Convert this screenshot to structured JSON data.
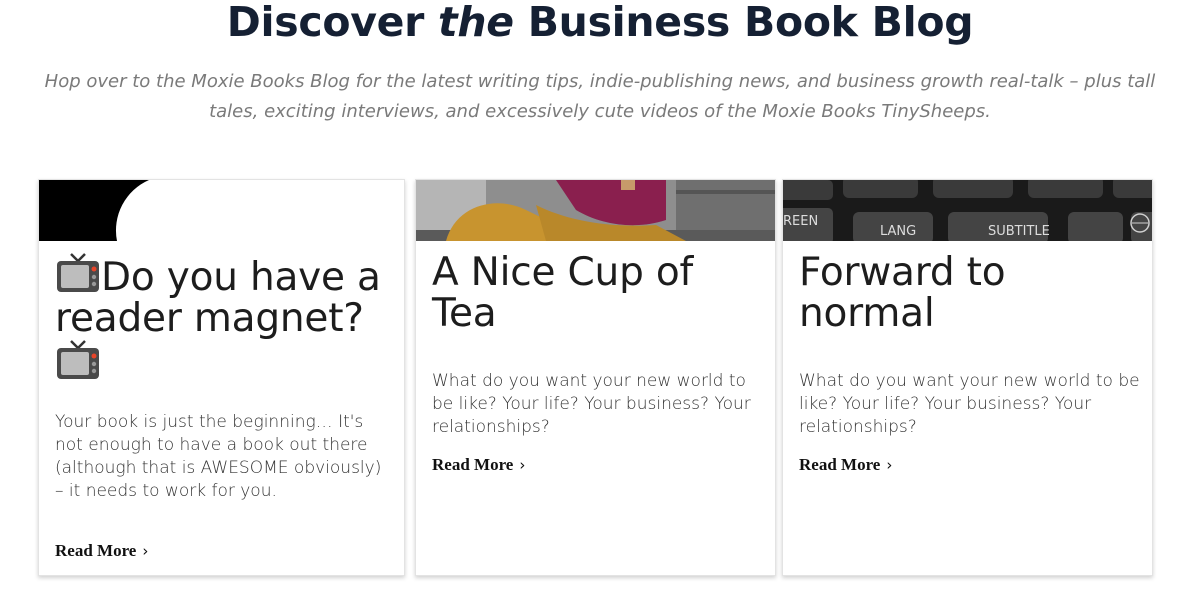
{
  "header": {
    "title_pre": "Discover ",
    "title_em": "the",
    "title_post": " Business Book Blog",
    "subtitle": "Hop over to the Moxie Books Blog for the latest writing tips, indie-publishing news, and business growth real-talk – plus tall tales, exciting interviews, and excessively cute videos of the Moxie Books TinySheeps."
  },
  "posts": [
    {
      "title": "Do you have a reader magnet?",
      "excerpt": "Your book is just the beginning… It's not enough to have a book out there (although that is AWESOME obviously) – it needs to work for you.",
      "read_more": "Read More",
      "thumb_icon": "black-white-graphic"
    },
    {
      "title": "A Nice Cup of Tea",
      "excerpt": "What do you want your new world to be like? Your life? Your business? Your relationships?",
      "read_more": "Read More",
      "thumb_icon": "person-sitting-photo"
    },
    {
      "title": "Forward to normal",
      "excerpt": "What do you want your new world to be like? Your life? Your business? Your relationships?",
      "read_more": "Read More",
      "thumb_icon": "remote-control-photo",
      "thumb_keys": [
        "REEN",
        "LANG",
        "SUBTITLE"
      ]
    }
  ],
  "colors": {
    "heading": "#152033",
    "subtitle": "#7a7a7a"
  }
}
